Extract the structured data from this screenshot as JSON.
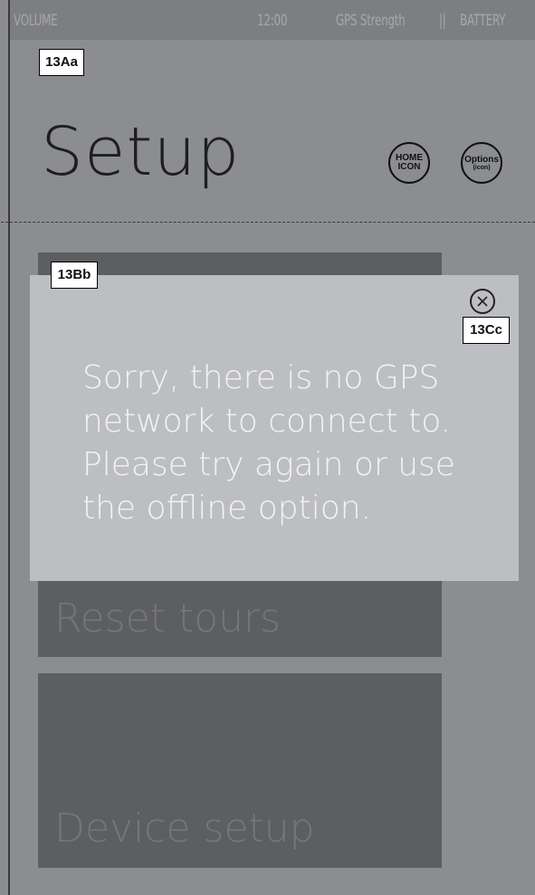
{
  "status_bar": {
    "volume": "VOLUME",
    "time": "12:00",
    "gps": "GPS Strength",
    "separator": "||",
    "battery": "BATTERY"
  },
  "annotations": {
    "header": "13Aa",
    "content": "13Bb",
    "close": "13Cc"
  },
  "header": {
    "title": "Setup",
    "home_icon_label_1": "HOME",
    "home_icon_label_2": "ICON",
    "options_label": "Options",
    "options_sub": "(icon)"
  },
  "menu": {
    "items": [
      {
        "label": ""
      },
      {
        "label": "Reset tours"
      },
      {
        "label": "Device setup"
      }
    ]
  },
  "modal": {
    "message": "Sorry, there is no GPS network to connect to. Please try again or use the offline option.",
    "close_icon": "close-circle-icon"
  },
  "colors": {
    "background": "#8c8d90",
    "tile": "#5d5e62",
    "modal": "#bdbec2",
    "modal_text": "#f2f3f4"
  }
}
